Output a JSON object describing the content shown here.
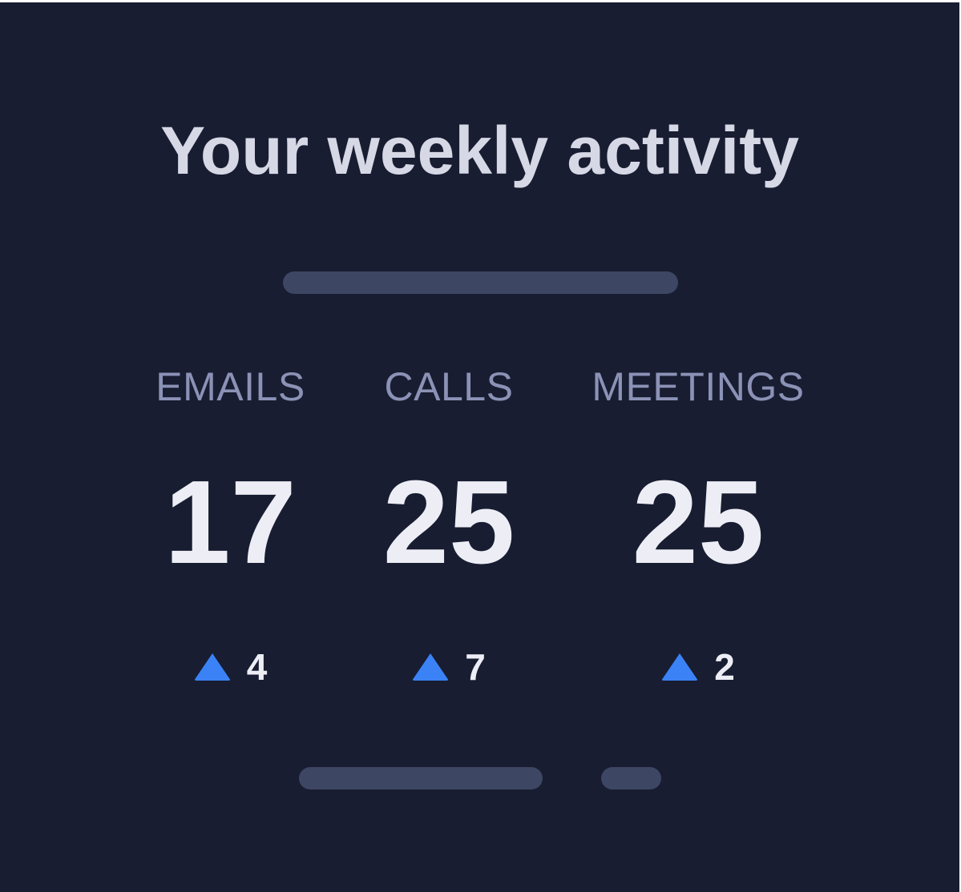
{
  "title": "Your weekly activity",
  "stats": [
    {
      "label": "EMAILS",
      "value": "17",
      "delta": "4",
      "trend": "up"
    },
    {
      "label": "CALLS",
      "value": "25",
      "delta": "7",
      "trend": "up"
    },
    {
      "label": "MEETINGS",
      "value": "25",
      "delta": "2",
      "trend": "up"
    }
  ],
  "icons": {
    "trend_up": "triangle-up-icon"
  },
  "colors": {
    "background": "#181d31",
    "title": "#d6d8e6",
    "label": "#8b92b6",
    "value": "#edeef5",
    "accent": "#3b82f6",
    "placeholder": "#3d4663"
  }
}
